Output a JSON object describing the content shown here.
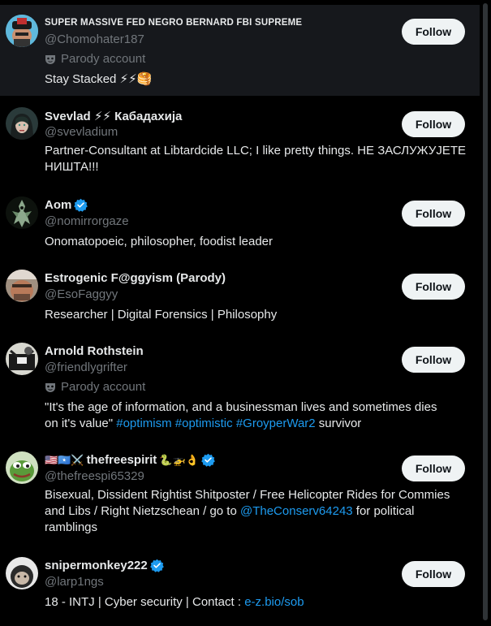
{
  "follow_label": "Follow",
  "parody_label": "Parody account",
  "accounts": [
    {
      "name": "SUPER MASSIVE FED NEGRO BERNARD FBI SUPREME",
      "handle": "@Chomohater187",
      "parody": true,
      "bio": "Stay Stacked ⚡⚡🥞"
    },
    {
      "name": "Svevlad ⚡⚡ Кабадахија",
      "handle": "@svevladium",
      "parody": false,
      "bio_l1": "Partner-Consultant at Libtardcide LLC; I like pretty things. НЕ ЗАСЛУЖУЈЕТЕ",
      "bio_l2": "НИШТА!!!"
    },
    {
      "name": "Aom",
      "handle": "@nomirrorgaze",
      "verified": true,
      "bio": "Onomatopoeic, philosopher, foodist leader"
    },
    {
      "name": "Estrogenic F@ggyism (Parody)",
      "handle": "@EsoFaggyy",
      "bio": "Researcher | Digital Forensics | Philosophy"
    },
    {
      "name": "Arnold Rothstein",
      "handle": "@friendlygrifter",
      "parody": true,
      "bio_l1": "\"It's the age of information, and a businessman lives and sometimes dies",
      "bio_l2_text": "on it's value\"",
      "bio_l2_tags": [
        "#optimism",
        "#optimistic",
        "#GroyperWar2"
      ],
      "bio_l2_tail": "survivor"
    },
    {
      "name_prefix": "🇺🇸🇸🇴⚔️",
      "name": "thefreespirit",
      "name_suffix": "🐍🚁👌",
      "handle": "@thefreespi65329",
      "verified": true,
      "bio_l1": "Bisexual, Dissident Rightist Shitposter / Free Helicopter Rides for Commies",
      "bio_l2_pre": "and Libs / Right Nietzschean / go to",
      "bio_l2_link": "@TheConserv64243",
      "bio_l2_post": "for political",
      "bio_l3": "ramblings"
    },
    {
      "name": "snipermonkey222",
      "handle": "@larp1ngs",
      "verified": true,
      "bio_pre": "18 - INTJ | Cyber security | Contact :",
      "bio_link": "e-z.bio/sob"
    }
  ],
  "colors": {
    "background": "#000000",
    "highlight_row": "#16181c",
    "text": "#e7e9ea",
    "secondary": "#71767b",
    "link": "#1d9bf0",
    "button_bg": "#eff3f4"
  }
}
